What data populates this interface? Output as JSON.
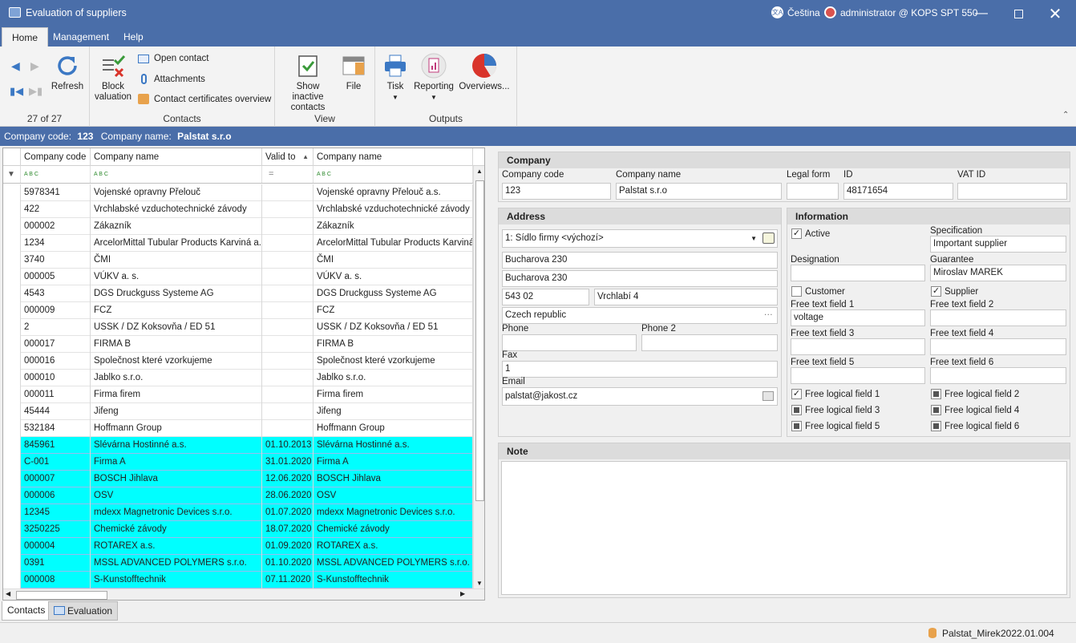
{
  "window": {
    "title": "Evaluation of suppliers",
    "language": "Čeština",
    "user": "administrator @ KOPS SPT 550"
  },
  "menu": {
    "tabs": [
      "Home",
      "Management",
      "Help"
    ]
  },
  "ribbon": {
    "nav": {
      "refresh": "Refresh",
      "position": "27 of 27"
    },
    "contacts": {
      "block_valuation": "Block valuation",
      "open_contact": "Open contact",
      "attachments": "Attachments",
      "certificates": "Contact certificates overview",
      "group": "Contacts"
    },
    "view": {
      "show_inactive": "Show inactive contacts",
      "file": "File",
      "group": "View"
    },
    "outputs": {
      "tisk": "Tisk",
      "reporting": "Reporting",
      "overviews": "Overviews...",
      "group": "Outputs"
    }
  },
  "infobar": {
    "code_label": "Company code:",
    "code": "123",
    "name_label": "Company name:",
    "name": "Palstat s.r.o"
  },
  "grid": {
    "columns": [
      "Company code",
      "Company name",
      "Valid to",
      "Company name"
    ],
    "rows": [
      {
        "code": "5978341",
        "name": "Vojenské opravny Přelouč",
        "valid": "",
        "name2": "Vojenské opravny Přelouč a.s.",
        "hl": false
      },
      {
        "code": "422",
        "name": "Vrchlabské vzduchotechnické závody",
        "valid": "",
        "name2": "Vrchlabské vzduchotechnické závody",
        "hl": false
      },
      {
        "code": "000002",
        "name": "Zákazník",
        "valid": "",
        "name2": "Zákazník",
        "hl": false
      },
      {
        "code": "1234",
        "name": "ArcelorMittal Tubular Products Karviná a.s.",
        "valid": "",
        "name2": "ArcelorMittal Tubular Products Karviná a",
        "hl": false
      },
      {
        "code": "3740",
        "name": "ČMI",
        "valid": "",
        "name2": "ČMI",
        "hl": false
      },
      {
        "code": "000005",
        "name": "VÚKV a. s.",
        "valid": "",
        "name2": "VÚKV a. s.",
        "hl": false
      },
      {
        "code": "4543",
        "name": "DGS Druckguss Systeme AG",
        "valid": "",
        "name2": "DGS Druckguss Systeme AG",
        "hl": false
      },
      {
        "code": "000009",
        "name": "FCZ",
        "valid": "",
        "name2": "FCZ",
        "hl": false
      },
      {
        "code": "2",
        "name": "USSK / DZ Koksovňa / ED 51",
        "valid": "",
        "name2": "USSK / DZ Koksovňa / ED 51",
        "hl": false
      },
      {
        "code": "000017",
        "name": "FIRMA B",
        "valid": "",
        "name2": "FIRMA B",
        "hl": false
      },
      {
        "code": "000016",
        "name": "Společnost které vzorkujeme",
        "valid": "",
        "name2": "Společnost které vzorkujeme",
        "hl": false
      },
      {
        "code": "000010",
        "name": "Jablko s.r.o.",
        "valid": "",
        "name2": "Jablko s.r.o.",
        "hl": false
      },
      {
        "code": "000011",
        "name": "Firma firem",
        "valid": "",
        "name2": "Firma firem",
        "hl": false
      },
      {
        "code": "45444",
        "name": "Jifeng",
        "valid": "",
        "name2": "Jifeng",
        "hl": false
      },
      {
        "code": "532184",
        "name": "Hoffmann Group",
        "valid": "",
        "name2": "Hoffmann Group",
        "hl": false
      },
      {
        "code": "845961",
        "name": "Slévárna Hostinné a.s.",
        "valid": "01.10.2013",
        "name2": "Slévárna Hostinné a.s.",
        "hl": true
      },
      {
        "code": "C-001",
        "name": "Firma A",
        "valid": "31.01.2020",
        "name2": "Firma A",
        "hl": true
      },
      {
        "code": "000007",
        "name": "BOSCH Jihlava",
        "valid": "12.06.2020",
        "name2": "BOSCH Jihlava",
        "hl": true
      },
      {
        "code": "000006",
        "name": "OSV",
        "valid": "28.06.2020",
        "name2": "OSV",
        "hl": true
      },
      {
        "code": "12345",
        "name": "mdexx Magnetronic Devices s.r.o.",
        "valid": "01.07.2020",
        "name2": "mdexx Magnetronic Devices s.r.o.",
        "hl": true
      },
      {
        "code": "3250225",
        "name": "Chemické závody",
        "valid": "18.07.2020",
        "name2": "Chemické závody",
        "hl": true
      },
      {
        "code": "000004",
        "name": "ROTAREX a.s.",
        "valid": "01.09.2020",
        "name2": "ROTAREX a.s.",
        "hl": true
      },
      {
        "code": "0391",
        "name": "MSSL ADVANCED POLYMERS s.r.o.",
        "valid": "01.10.2020",
        "name2": "MSSL ADVANCED POLYMERS s.r.o.",
        "hl": true
      },
      {
        "code": "000008",
        "name": "S-Kunstofftechnik",
        "valid": "07.11.2020",
        "name2": "S-Kunstofftechnik",
        "hl": true
      }
    ]
  },
  "bottom_tabs": [
    "Contacts",
    "Evaluation"
  ],
  "company": {
    "header": "Company",
    "code_label": "Company code",
    "code": "123",
    "name_label": "Company name",
    "name": "Palstat s.r.o",
    "legal_label": "Legal form",
    "legal": "",
    "id_label": "ID",
    "id": "48171654",
    "vat_label": "VAT ID",
    "vat": ""
  },
  "address": {
    "header": "Address",
    "type": "1: Sídlo firmy <výchozí>",
    "street1": "Bucharova 230",
    "street2": "Bucharova 230",
    "zip": "543 02",
    "city": "Vrchlabí 4",
    "country": "Czech republic",
    "phone_label": "Phone",
    "phone": "",
    "phone2_label": "Phone 2",
    "phone2": "",
    "fax_label": "Fax",
    "fax": "1",
    "email_label": "Email",
    "email": "palstat@jakost.cz"
  },
  "information": {
    "header": "Information",
    "active": "Active",
    "spec_label": "Specification",
    "spec": "Important supplier",
    "designation_label": "Designation",
    "designation": "",
    "guarantee_label": "Guarantee",
    "guarantee": "Miroslav MAREK",
    "customer": "Customer",
    "supplier": "Supplier",
    "f1_label": "Free text field 1",
    "f1": "voltage",
    "f2_label": "Free text field 2",
    "f2": "",
    "f3_label": "Free text field 3",
    "f3": "",
    "f4_label": "Free text field 4",
    "f4": "",
    "f5_label": "Free text field 5",
    "f5": "",
    "f6_label": "Free text field 6",
    "f6": "",
    "l1": "Free logical field 1",
    "l2": "Free logical field 2",
    "l3": "Free logical field 3",
    "l4": "Free logical field 4",
    "l5": "Free logical field 5",
    "l6": "Free logical field 6"
  },
  "note": {
    "header": "Note",
    "text": ""
  },
  "status": {
    "db": "Palstat_Mirek",
    "version": "2022.01.004"
  }
}
